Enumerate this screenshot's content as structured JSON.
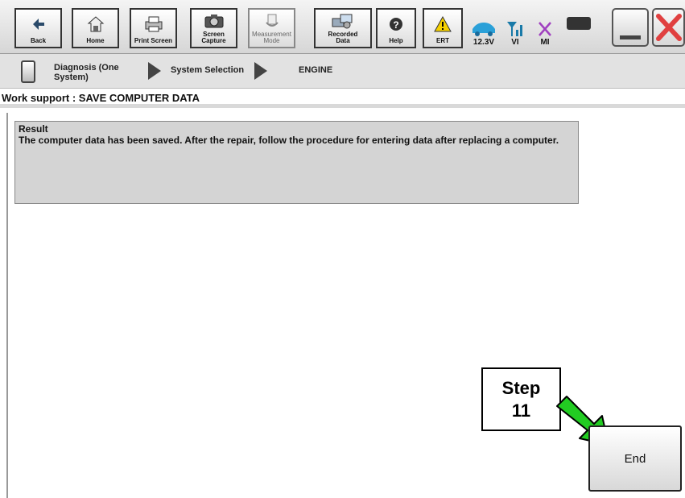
{
  "toolbar": {
    "back": "Back",
    "home": "Home",
    "print_screen": "Print Screen",
    "screen_capture": "Screen\nCapture",
    "measurement_mode": "Measurement\nMode",
    "recorded_data": "Recorded\nData",
    "help": "Help",
    "ert": "ERT",
    "voltage": "12.3V",
    "vi": "VI",
    "mi": "MI"
  },
  "breadcrumb": {
    "item1": "Diagnosis (One\nSystem)",
    "item2": "System Selection",
    "item3": "ENGINE"
  },
  "page_title": "Work support : SAVE COMPUTER DATA",
  "result": {
    "heading": "Result",
    "message": "The computer data has been saved. After the repair, follow the procedure for entering data after replacing a computer."
  },
  "callout": {
    "line1": "Step",
    "line2": "11"
  },
  "end_button": "End",
  "colors": {
    "arrow_green": "#22cc22",
    "close_red": "#e04040"
  }
}
